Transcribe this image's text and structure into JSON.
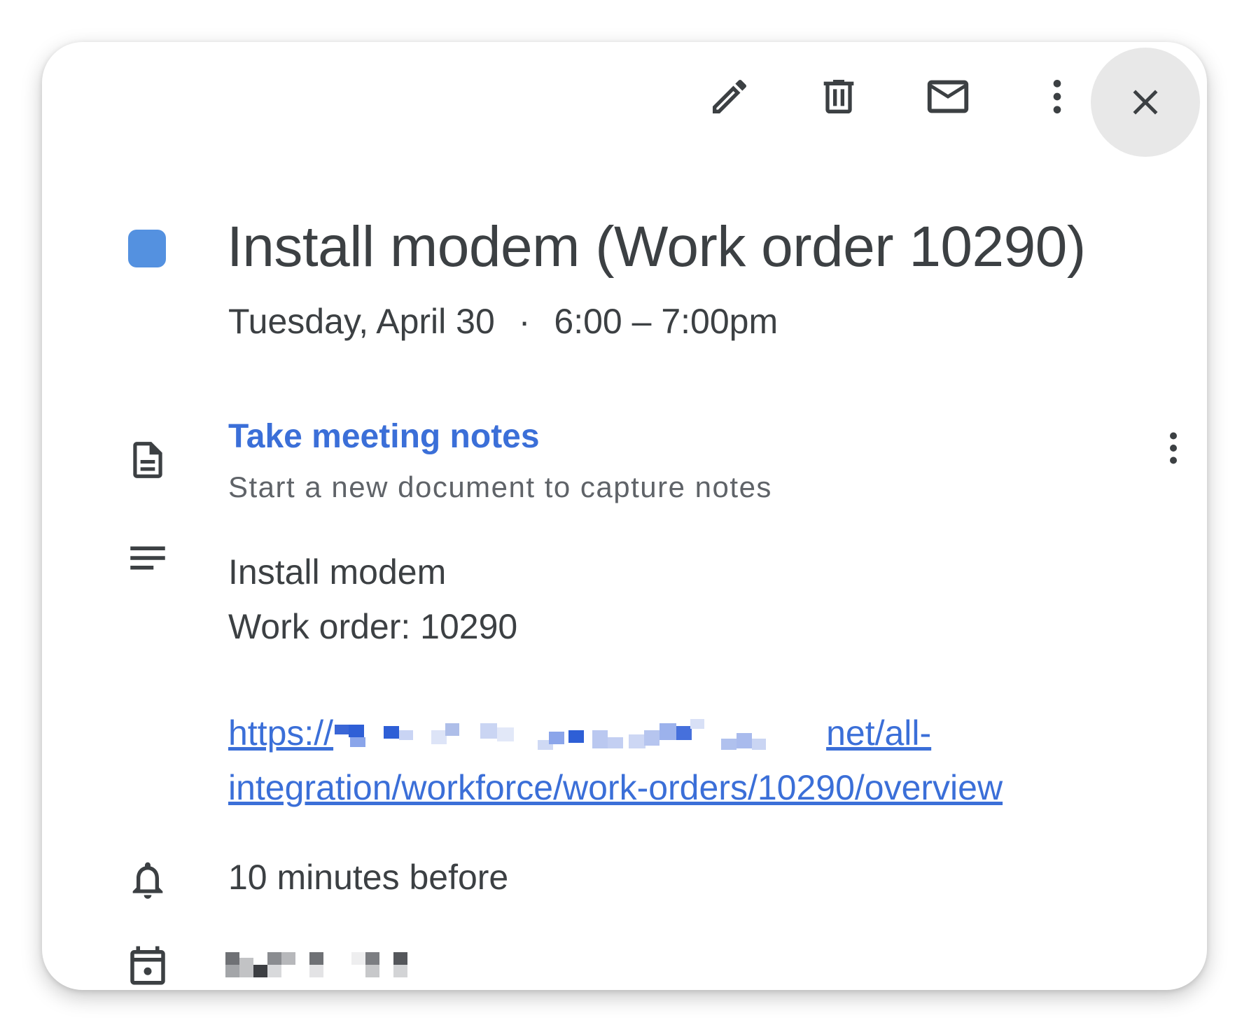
{
  "toolbar": {
    "edit_icon": "pencil-icon",
    "delete_icon": "trash-icon",
    "email_icon": "mail-icon",
    "more_icon": "more-vert-icon",
    "close_icon": "close-icon"
  },
  "event": {
    "color": "#5491e0",
    "title": "Install modem (Work order 10290)",
    "date": "Tuesday, April 30",
    "separator": "·",
    "time": "6:00 – 7:00pm"
  },
  "notes": {
    "icon": "document-icon",
    "title": "Take meeting notes",
    "subtitle": "Start a new document to capture notes",
    "more_icon": "more-vert-icon"
  },
  "description": {
    "icon": "description-lines-icon",
    "line1": "Install modem",
    "line2": "Work order: 10290",
    "link_prefix": "https://",
    "link_suffix": "net/all-",
    "link_line2": "integration/workforce/work-orders/10290/overview"
  },
  "reminder": {
    "icon": "bell-icon",
    "text": "10 minutes before"
  },
  "calendar": {
    "icon": "calendar-icon"
  }
}
